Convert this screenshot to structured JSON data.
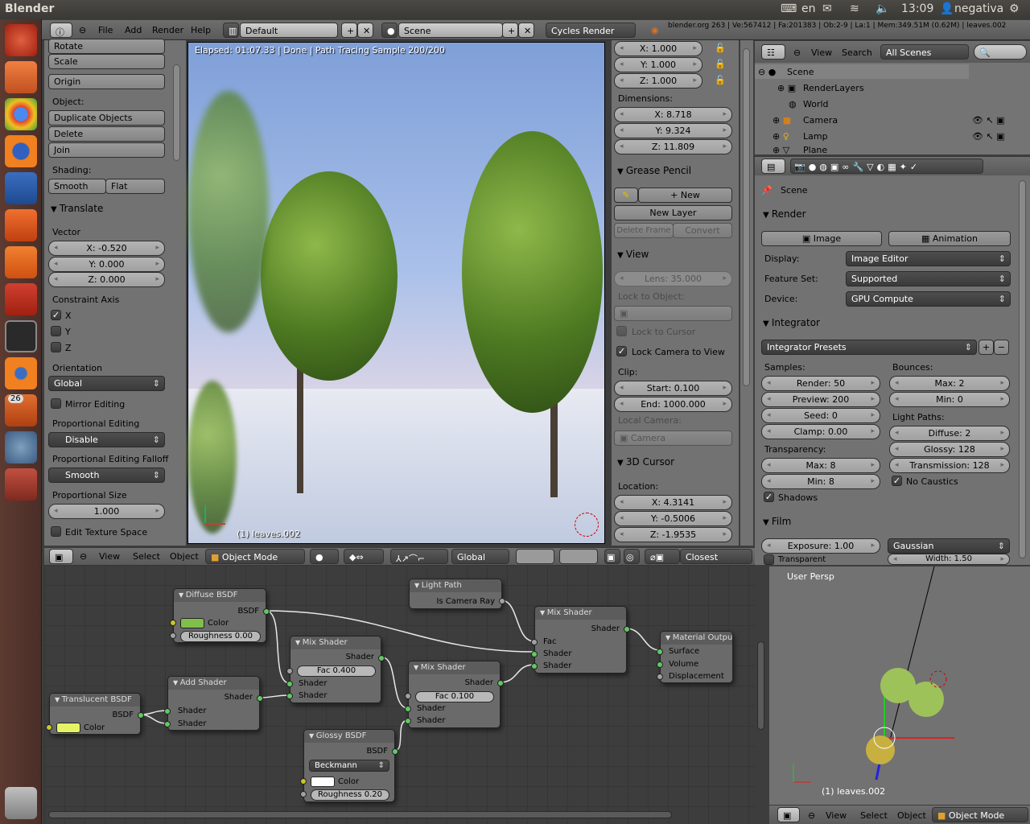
{
  "system": {
    "app": "Blender",
    "lang": "en",
    "time": "13:09",
    "user": "negativa"
  },
  "launcher": [
    "ubuntu-dash-icon",
    "files-icon",
    "chrome-icon",
    "firefox-icon",
    "writer-icon",
    "box-icon",
    "ubuntu-one-icon",
    "settings-icon",
    "terminal-icon",
    "blender-icon",
    "update-icon",
    "gimp-icon",
    "workspace-icon",
    "trash-icon"
  ],
  "launcher_badge": "26",
  "header": {
    "menus": [
      "File",
      "Add",
      "Render",
      "Help"
    ],
    "layout": "Default",
    "scene": "Scene",
    "engine": "Cycles Render",
    "stats": "blender.org 263 | Ve:567412 | Fa:201383 | Ob:2-9 | La:1 | Mem:349.51M (0.62M) | leaves.002"
  },
  "tools": {
    "rotate": "Rotate",
    "scale": "Scale",
    "origin": "Origin",
    "object_label": "Object:",
    "duplicate": "Duplicate Objects",
    "delete": "Delete",
    "join": "Join",
    "shading_label": "Shading:",
    "smooth": "Smooth",
    "flat": "Flat",
    "translate": "Translate",
    "vector": "Vector",
    "vx": "X: -0.520",
    "vy": "Y: 0.000",
    "vz": "Z: 0.000",
    "constraint": "Constraint Axis",
    "cx": "X",
    "cy": "Y",
    "cz": "Z",
    "cx_checked": true,
    "orientation": "Orientation",
    "orientation_value": "Global",
    "mirror": "Mirror Editing",
    "prop_edit": "Proportional Editing",
    "prop_edit_value": "Disable",
    "falloff": "Proportional Editing Falloff",
    "falloff_value": "Smooth",
    "prop_size": "Proportional Size",
    "prop_size_value": "1.000",
    "edit_tex": "Edit Texture Space"
  },
  "viewport": {
    "status": "Elapsed: 01:07.33 | Done | Path Tracing Sample 200/200",
    "object": "(1) leaves.002",
    "progress": 1.0
  },
  "npanel": {
    "sx": "X: 1.000",
    "sy": "Y: 1.000",
    "sz": "Z: 1.000",
    "dimensions": "Dimensions:",
    "dx": "X: 8.718",
    "dy": "Y: 9.324",
    "dz": "Z: 11.809",
    "grease": "Grease Pencil",
    "new": "New",
    "new_layer": "New Layer",
    "delete_frame": "Delete Frame",
    "convert": "Convert",
    "view": "View",
    "lens": "Lens: 35.000",
    "lock_obj": "Lock to Object:",
    "lock_cursor": "Lock to Cursor",
    "lock_cam": "Lock Camera to View",
    "clip": "Clip:",
    "start": "Start: 0.100",
    "end": "End: 1000.000",
    "local_cam": "Local Camera:",
    "camera": "Camera",
    "cursor": "3D Cursor",
    "location": "Location:",
    "lx": "X: 4.3141",
    "ly": "Y: -0.5006",
    "lz": "Z: -1.9535"
  },
  "outliner": {
    "menus": [
      "View",
      "Search"
    ],
    "filter": "All Scenes",
    "items": [
      "Scene",
      "RenderLayers",
      "World",
      "Camera",
      "Lamp",
      "Plane"
    ]
  },
  "props": {
    "scene": "Scene",
    "render": "Render",
    "image": "Image",
    "animation": "Animation",
    "display_label": "Display:",
    "display": "Image Editor",
    "feature_label": "Feature Set:",
    "feature": "Supported",
    "device_label": "Device:",
    "device": "GPU Compute",
    "integrator": "Integrator",
    "presets": "Integrator Presets",
    "samples": "Samples:",
    "render_s": "Render: 50",
    "preview_s": "Preview: 200",
    "seed": "Seed: 0",
    "clamp": "Clamp: 0.00",
    "transparency": "Transparency:",
    "tmax": "Max: 8",
    "tmin": "Min: 8",
    "shadows": "Shadows",
    "bounces": "Bounces:",
    "bmax": "Max: 2",
    "bmin": "Min: 0",
    "light_paths": "Light Paths:",
    "diffuse": "Diffuse: 2",
    "glossy": "Glossy: 128",
    "transmission": "Transmission: 128",
    "no_caustics": "No Caustics",
    "film": "Film",
    "exposure": "Exposure: 1.00",
    "filter": "Gaussian",
    "transparent": "Transparent",
    "width": "Width: 1.50"
  },
  "view3d_header": {
    "menus": [
      "View",
      "Select",
      "Object"
    ],
    "mode": "Object Mode",
    "orientation": "Global",
    "snap": "Closest"
  },
  "nodes": {
    "diffuse": {
      "title": "Diffuse BSDF",
      "out": "BSDF",
      "color": "Color",
      "roughness": "Roughness 0.00",
      "color_hex": "#7fbf4a"
    },
    "lightpath": {
      "title": "Light Path",
      "out": "Is Camera Ray"
    },
    "mix1": {
      "title": "Mix Shader",
      "out": "Shader",
      "fac": "Fac",
      "s1": "Shader",
      "s2": "Shader"
    },
    "output": {
      "title": "Material Outpu",
      "surface": "Surface",
      "volume": "Volume",
      "disp": "Displacement"
    },
    "mix2": {
      "title": "Mix Shader",
      "out": "Shader",
      "fac": "Fac 0.400",
      "s1": "Shader",
      "s2": "Shader"
    },
    "mix3": {
      "title": "Mix Shader",
      "out": "Shader",
      "fac": "Fac 0.100",
      "s1": "Shader",
      "s2": "Shader"
    },
    "add": {
      "title": "Add Shader",
      "out": "Shader",
      "s1": "Shader",
      "s2": "Shader"
    },
    "translucent": {
      "title": "Translucent BSDF",
      "out": "BSDF",
      "color": "Color",
      "color_hex": "#e6f266"
    },
    "glossy": {
      "title": "Glossy BSDF",
      "out": "BSDF",
      "dist": "Beckmann",
      "color": "Color",
      "roughness": "Roughness 0.20",
      "color_hex": "#ffffff"
    }
  },
  "mini3d": {
    "view": "User Persp",
    "object": "(1) leaves.002",
    "menus": [
      "View",
      "Select",
      "Object"
    ],
    "mode": "Object Mode"
  }
}
